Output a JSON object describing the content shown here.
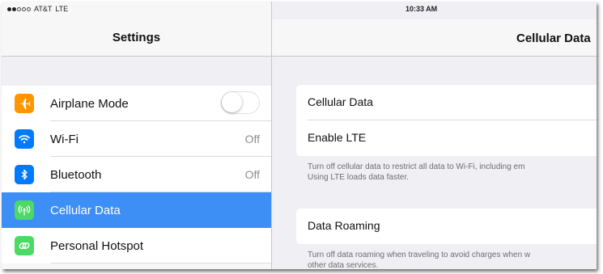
{
  "status": {
    "carrier": "AT&T",
    "network": "LTE",
    "time": "10:33 AM"
  },
  "left_pane": {
    "title": "Settings",
    "items": [
      {
        "label": "Airplane Mode",
        "value": "",
        "icon": "airplane-icon",
        "color": "#ff9500"
      },
      {
        "label": "Wi-Fi",
        "value": "Off",
        "icon": "wifi-icon",
        "color": "#007aff"
      },
      {
        "label": "Bluetooth",
        "value": "Off",
        "icon": "bluetooth-icon",
        "color": "#007aff"
      },
      {
        "label": "Cellular Data",
        "value": "",
        "icon": "antenna-icon",
        "color": "#4cd964"
      },
      {
        "label": "Personal Hotspot",
        "value": "",
        "icon": "hotspot-icon",
        "color": "#4cd964"
      }
    ],
    "airplane_mode_on": false,
    "selected_color": "#3d8ef5"
  },
  "right_pane": {
    "title": "Cellular Data",
    "group1": {
      "items": [
        {
          "label": "Cellular Data"
        },
        {
          "label": "Enable LTE"
        }
      ],
      "footnote_line1": "Turn off cellular data to restrict all data to Wi-Fi, including em",
      "footnote_line2": "Using LTE loads data faster."
    },
    "group2": {
      "items": [
        {
          "label": "Data Roaming"
        }
      ],
      "footnote_line1": "Turn off data roaming when traveling to avoid charges when w",
      "footnote_line2": "other data services."
    }
  }
}
